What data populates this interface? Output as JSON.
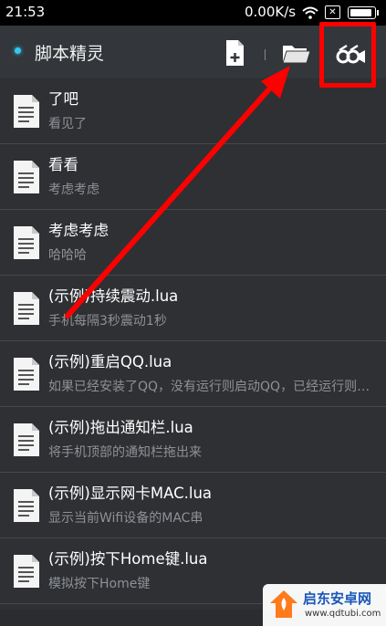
{
  "status_bar": {
    "time": "21:53",
    "network_speed": "0.00K/s",
    "sim_label": "✕"
  },
  "toolbar": {
    "app_title": "脚本精灵",
    "accent_color": "#35c7f0",
    "buttons": [
      {
        "name": "add-script-button",
        "icon": "file-plus-icon"
      },
      {
        "name": "open-folder-button",
        "icon": "folder-icon"
      },
      {
        "name": "record-button",
        "icon": "camera-record-icon"
      }
    ]
  },
  "scripts": [
    {
      "title": "了吧",
      "subtitle": "看见了"
    },
    {
      "title": "看看",
      "subtitle": "考虑考虑"
    },
    {
      "title": "考虑考虑",
      "subtitle": "哈哈哈"
    },
    {
      "title": "(示例)持续震动.lua",
      "subtitle": "手机每隔3秒震动1秒"
    },
    {
      "title": "(示例)重启QQ.lua",
      "subtitle": "如果已经安装了QQ，没有运行则启动QQ，已经运行则重启QQ"
    },
    {
      "title": "(示例)拖出通知栏.lua",
      "subtitle": "将手机顶部的通知栏拖出来"
    },
    {
      "title": "(示例)显示网卡MAC.lua",
      "subtitle": "显示当前Wifi设备的MAC串"
    },
    {
      "title": "(示例)按下Home键.lua",
      "subtitle": "模拟按下Home键"
    }
  ],
  "annotation": {
    "highlight_color": "#ff0000"
  },
  "watermark": {
    "name": "启东安卓网",
    "url": "www.qdtubi.com"
  }
}
